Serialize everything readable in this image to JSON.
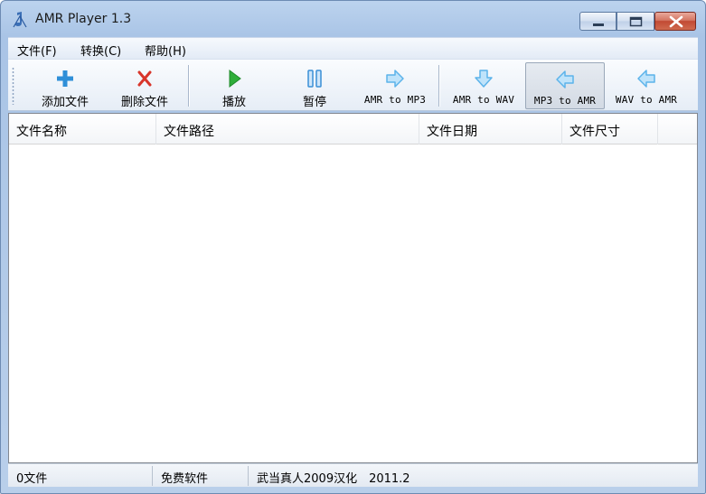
{
  "window": {
    "title": "AMR Player 1.3"
  },
  "menu": [
    {
      "label": "文件(F)"
    },
    {
      "label": "转换(C)"
    },
    {
      "label": "帮助(H)"
    }
  ],
  "toolbar": {
    "add": "添加文件",
    "delete": "删除文件",
    "play": "播放",
    "pause": "暂停",
    "amr_to_mp3": "AMR to MP3",
    "amr_to_wav": "AMR to WAV",
    "mp3_to_amr": "MP3 to AMR",
    "wav_to_amr": "WAV to AMR"
  },
  "file_list": {
    "columns": [
      "文件名称",
      "文件路径",
      "文件日期",
      "文件尺寸"
    ],
    "rows": []
  },
  "status": {
    "count": "0文件",
    "license": "免费软件",
    "credit": "武当真人2009汉化　2011.2"
  },
  "colors": {
    "add_icon": "#2f8fd8",
    "delete_icon": "#d8352a",
    "play_icon": "#2fae3a",
    "pause_icon": "#3a8fd6",
    "convert_arrow": "#5cb3ea"
  },
  "icons": {
    "app": "music-note-icon",
    "add": "plus-icon",
    "delete": "x-icon",
    "play": "play-icon",
    "pause": "pause-icon",
    "convert_right": "arrow-right-icon",
    "convert_down": "arrow-down-icon",
    "convert_left": "arrow-left-icon"
  }
}
